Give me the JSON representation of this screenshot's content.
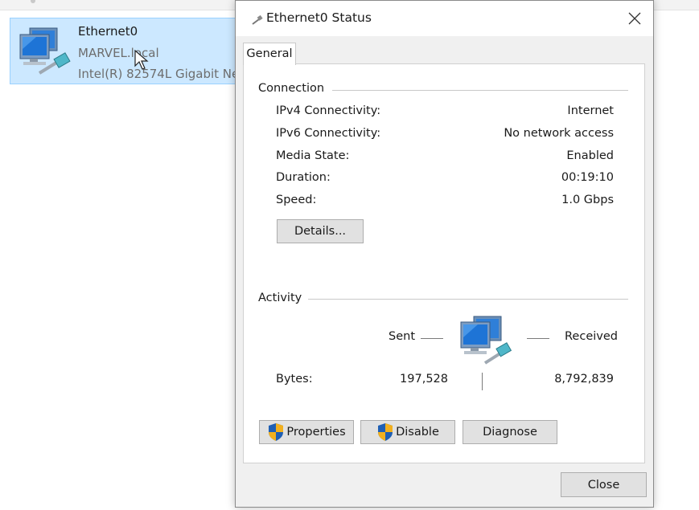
{
  "background": {
    "adapter": {
      "name": "Ethernet0",
      "domain": "MARVEL.local",
      "description": "Intel(R) 82574L Gigabit Ne"
    }
  },
  "dialog": {
    "title": "Ethernet0 Status",
    "tab_general": "General",
    "connection": {
      "group_label": "Connection",
      "rows": [
        {
          "label": "IPv4 Connectivity:",
          "value": "Internet"
        },
        {
          "label": "IPv6 Connectivity:",
          "value": "No network access"
        },
        {
          "label": "Media State:",
          "value": "Enabled"
        },
        {
          "label": "Duration:",
          "value": "00:19:10"
        },
        {
          "label": "Speed:",
          "value": "1.0 Gbps"
        }
      ],
      "details_button": "Details..."
    },
    "activity": {
      "group_label": "Activity",
      "sent_label": "Sent",
      "received_label": "Received",
      "bytes_label": "Bytes:",
      "bytes_sent": "197,528",
      "bytes_received": "8,792,839"
    },
    "buttons": {
      "properties": "Properties",
      "disable": "Disable",
      "diagnose": "Diagnose",
      "close": "Close"
    }
  },
  "colors": {
    "selection_bg": "#cce8ff",
    "selection_border": "#99d1ff",
    "dialog_bg": "#f0f0f0",
    "button_bg": "#e1e1e1"
  },
  "icons": [
    "network-adapter-icon",
    "network-computers-icon",
    "uac-shield-icon",
    "close-icon",
    "cursor-icon"
  ]
}
